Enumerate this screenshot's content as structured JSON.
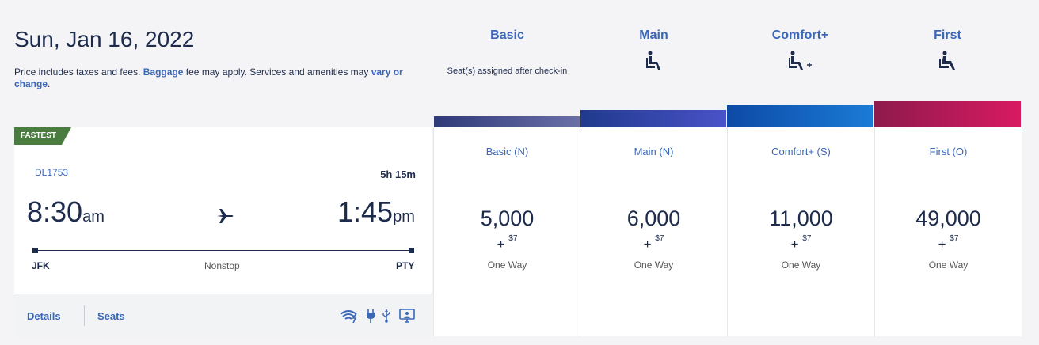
{
  "header": {
    "date": "Sun, Jan 16, 2022",
    "note_pre": "Price includes taxes and fees.",
    "note_link1": "Baggage",
    "note_mid": "fee may apply. Services and amenities may",
    "note_link2": "vary or change",
    "note_end": "."
  },
  "cabins": [
    {
      "name": "Basic",
      "sub": "Seat(s) assigned after check-in",
      "icon": "none",
      "color": "#404a86"
    },
    {
      "name": "Main",
      "icon": "seat-icon",
      "color": "#3243a6"
    },
    {
      "name": "Comfort+",
      "icon": "seat-plus-icon",
      "color": "#0e62c2"
    },
    {
      "name": "First",
      "icon": "seat-icon",
      "color": "#b5135a"
    }
  ],
  "flight": {
    "badge": "FASTEST",
    "number": "DL1753",
    "duration": "5h 15m",
    "depart_time": "8:30",
    "depart_ampm": "am",
    "arrive_time": "1:45",
    "arrive_ampm": "pm",
    "origin": "JFK",
    "destination": "PTY",
    "stops": "Nonstop",
    "details_label": "Details",
    "seats_label": "Seats",
    "amenities": [
      "wifi-icon",
      "power-icon",
      "usb-icon",
      "entertainment-icon"
    ]
  },
  "fares": [
    {
      "cabin": "Basic (N)",
      "miles": "5,000",
      "plus": "+",
      "fee": "$7",
      "trip": "One Way"
    },
    {
      "cabin": "Main (N)",
      "miles": "6,000",
      "plus": "+",
      "fee": "$7",
      "trip": "One Way"
    },
    {
      "cabin": "Comfort+ (S)",
      "miles": "11,000",
      "plus": "+",
      "fee": "$7",
      "trip": "One Way"
    },
    {
      "cabin": "First (O)",
      "miles": "49,000",
      "plus": "+",
      "fee": "$7",
      "trip": "One Way"
    }
  ]
}
